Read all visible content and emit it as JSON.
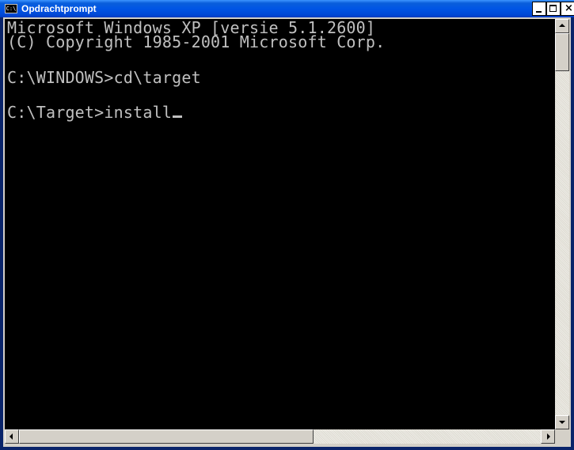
{
  "window": {
    "title": "Opdrachtprompt",
    "icon": "cmd-console-icon",
    "icon_text": "C:\\",
    "buttons": {
      "minimize": "minimize-icon",
      "maximize": "maximize-icon",
      "close": "close-icon"
    }
  },
  "console": {
    "lines": [
      "Microsoft Windows XP [versie 5.1.2600]",
      "(C) Copyright 1985-2001 Microsoft Corp.",
      "C:\\WINDOWS>cd\\target",
      "C:\\Target>install"
    ],
    "text_color": "#c0c0c0",
    "background_color": "#000000"
  },
  "scrollbars": {
    "vertical": {
      "up": "scroll-up-icon",
      "down": "scroll-down-icon"
    },
    "horizontal": {
      "left": "scroll-left-icon",
      "right": "scroll-right-icon"
    }
  },
  "colors": {
    "titlebar": "#0055e5",
    "frame": "#0a246a",
    "chrome": "#d4d0c8"
  }
}
